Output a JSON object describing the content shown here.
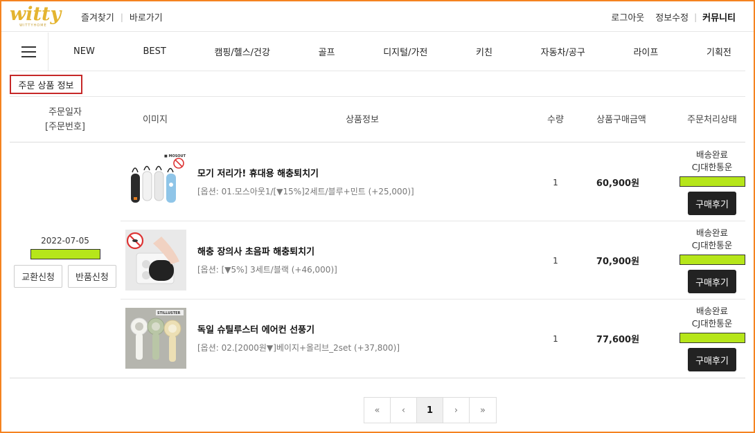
{
  "brand": {
    "logo_text": "witty",
    "accent": "#e4b430"
  },
  "top": {
    "left_links": [
      "즐겨찾기",
      "바로가기"
    ],
    "right_links": [
      "로그아웃",
      "정보수정",
      "커뮤니티"
    ]
  },
  "nav": {
    "menu_icon": "hamburger-icon",
    "items": [
      "NEW",
      "BEST",
      "캠핑/헬스/건강",
      "골프",
      "디지털/가전",
      "키친",
      "자동차/공구",
      "라이프",
      "기획전"
    ]
  },
  "section_title": "주문 상품 정보",
  "table": {
    "headers": {
      "date_line1": "주문일자",
      "date_line2": "[주문번호]",
      "image": "이미지",
      "info": "상품정보",
      "qty": "수량",
      "price": "상품구매금액",
      "status": "주문처리상태"
    },
    "order_date": "2022-07-05",
    "exchange_label": "교환신청",
    "return_label": "반품신청",
    "rows": [
      {
        "name": "모기 저리가! 휴대용 해충퇴치기",
        "option": "[옵션: 01.모스아웃1/[▼15%]2세트/블루+민트 (+25,000)]",
        "qty": "1",
        "price": "60,900원",
        "status1": "배송완료",
        "status2": "CJ대한통운",
        "review": "구매후기"
      },
      {
        "name": "해충 장의사 초음파 해충퇴치기",
        "option": "[옵션: [▼5%] 3세트/블랙 (+46,000)]",
        "qty": "1",
        "price": "70,900원",
        "status1": "배송완료",
        "status2": "CJ대한통운",
        "review": "구매후기"
      },
      {
        "name": "독일 슈틸루스터 에어컨 선풍기",
        "option": "[옵션: 02.[2000원▼]베이지+올리브_2set (+37,800)]",
        "qty": "1",
        "price": "77,600원",
        "status1": "배송완료",
        "status2": "CJ대한통운",
        "review": "구매후기"
      }
    ]
  },
  "pagination": {
    "first": "«",
    "prev": "‹",
    "current": "1",
    "next": "›",
    "last": "»"
  },
  "colors": {
    "frame": "#f5821f",
    "highlight_box": "#c62828",
    "redaction_green": "#b6e61a",
    "button_dark": "#222222"
  }
}
